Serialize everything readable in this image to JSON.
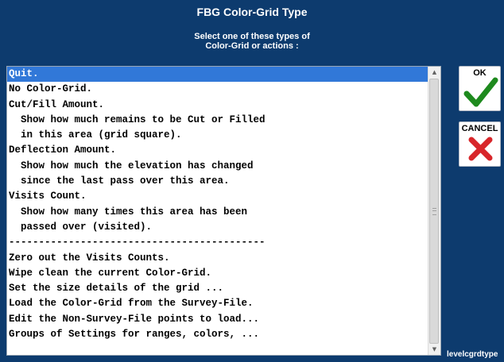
{
  "window": {
    "title": "FBG Color-Grid Type",
    "instruction_line1": "Select one of these types of",
    "instruction_line2": "Color-Grid or actions :"
  },
  "list": {
    "selected_index": 0,
    "items": [
      "Quit.",
      "No Color-Grid.",
      "Cut/Fill Amount.",
      "  Show how much remains to be Cut or Filled",
      "  in this area (grid square).",
      "Deflection Amount.",
      "  Show how much the elevation has changed",
      "  since the last pass over this area.",
      "Visits Count.",
      "  Show how many times this area has been",
      "  passed over (visited).",
      "-------------------------------------------",
      "Zero out the Visits Counts.",
      "Wipe clean the current Color-Grid.",
      "Set the size details of the grid ...",
      "Load the Color-Grid from the Survey-File.",
      "Edit the Non-Survey-File points to load...",
      "Groups of Settings for ranges, colors, ..."
    ]
  },
  "buttons": {
    "ok_label": "OK",
    "ok_icon": "checkmark-icon",
    "cancel_label": "CANCEL",
    "cancel_icon": "x-icon"
  },
  "footer": {
    "screen_id": "levelcgrdtype"
  },
  "colors": {
    "background": "#0d3b6e",
    "selection": "#3178d8",
    "check_green": "#1e8a1e",
    "cancel_red": "#d8262a"
  }
}
